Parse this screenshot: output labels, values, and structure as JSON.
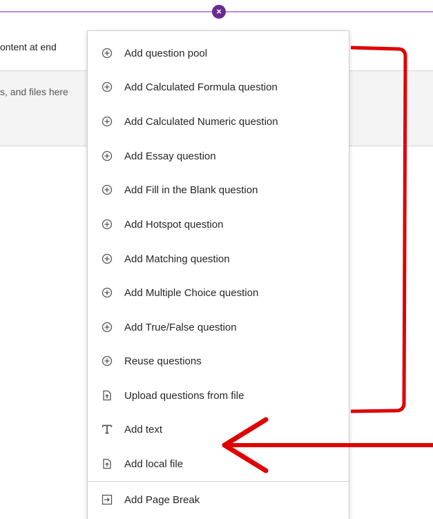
{
  "background": {
    "row1_text": "ontent at end",
    "row2_text": "s, and files here"
  },
  "divider": {
    "close_glyph": "×"
  },
  "menu": {
    "items": [
      {
        "label": "Add question pool",
        "icon": "plus-circle-icon"
      },
      {
        "label": "Add Calculated Formula question",
        "icon": "plus-circle-icon"
      },
      {
        "label": "Add Calculated Numeric question",
        "icon": "plus-circle-icon"
      },
      {
        "label": "Add Essay question",
        "icon": "plus-circle-icon"
      },
      {
        "label": "Add Fill in the Blank question",
        "icon": "plus-circle-icon"
      },
      {
        "label": "Add Hotspot question",
        "icon": "plus-circle-icon"
      },
      {
        "label": "Add Matching question",
        "icon": "plus-circle-icon"
      },
      {
        "label": "Add Multiple Choice question",
        "icon": "plus-circle-icon"
      },
      {
        "label": "Add True/False question",
        "icon": "plus-circle-icon"
      },
      {
        "label": "Reuse questions",
        "icon": "plus-circle-icon"
      },
      {
        "label": "Upload questions from file",
        "icon": "file-upload-icon"
      },
      {
        "label": "Add text",
        "icon": "text-icon"
      },
      {
        "label": "Add local file",
        "icon": "file-upload-icon"
      },
      {
        "label": "Add Page Break",
        "icon": "page-break-icon"
      }
    ]
  },
  "annotation_color": "#e00000",
  "accent_color": "#6b2a8f"
}
